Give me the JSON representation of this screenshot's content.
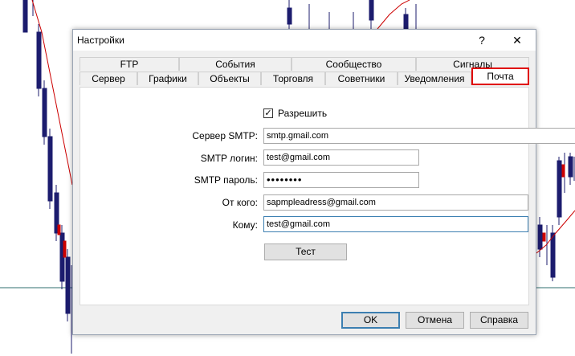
{
  "window": {
    "title": "Настройки",
    "help": "?",
    "close": "✕"
  },
  "tabs_row1": [
    "FTP",
    "События",
    "Сообщество",
    "Сигналы"
  ],
  "tabs_row2": [
    "Сервер",
    "Графики",
    "Объекты",
    "Торговля",
    "Советники",
    "Уведомления",
    "Почта"
  ],
  "active_tab": "Почта",
  "form": {
    "enable_label": "Разрешить",
    "enable_checked": true,
    "smtp_server_label": "Сервер SMTP:",
    "smtp_server_value": "smtp.gmail.com",
    "smtp_login_label": "SMTP логин:",
    "smtp_login_value": "test@gmail.com",
    "smtp_password_label": "SMTP пароль:",
    "smtp_password_value": "••••••••",
    "from_label": "От кого:",
    "from_value": "sapmpleadress@gmail.com",
    "to_label": "Кому:",
    "to_value": "test@gmail.com",
    "test_button": "Тест"
  },
  "buttons": {
    "ok": "OK",
    "cancel": "Отмена",
    "help": "Справка"
  },
  "colors": {
    "highlight": "#e00000",
    "focus_border": "#3c7fb1",
    "candle": "#1c1c6e",
    "ma_line": "#cc0000"
  }
}
